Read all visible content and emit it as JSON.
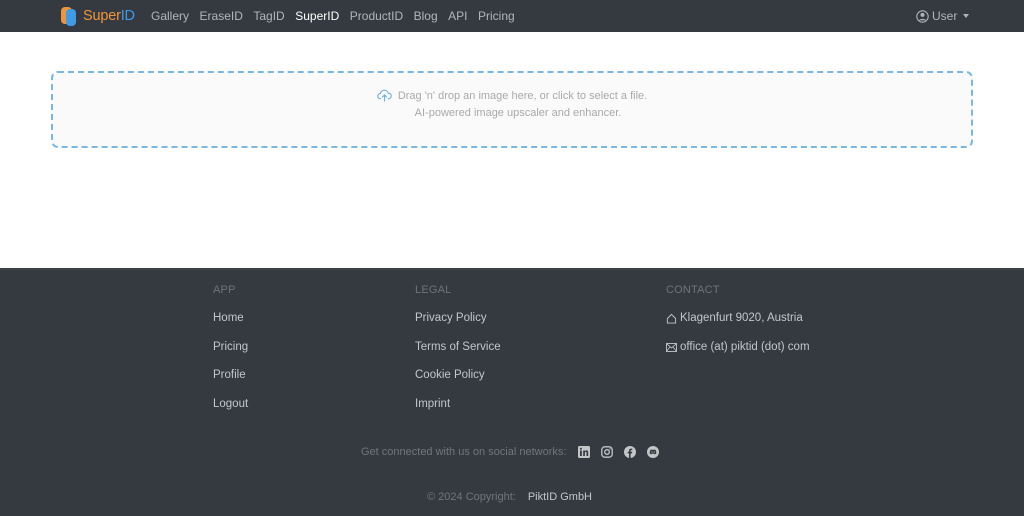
{
  "navbar": {
    "brand": {
      "part1": "Super",
      "part2": "ID"
    },
    "links": [
      {
        "label": "Gallery",
        "active": false
      },
      {
        "label": "EraseID",
        "active": false
      },
      {
        "label": "TagID",
        "active": false
      },
      {
        "label": "SuperID",
        "active": true
      },
      {
        "label": "ProductID",
        "active": false
      },
      {
        "label": "Blog",
        "active": false
      },
      {
        "label": "API",
        "active": false
      },
      {
        "label": "Pricing",
        "active": false
      }
    ],
    "user": {
      "icon": "user-circle-icon",
      "label": "User",
      "dropdown_icon": "caret-down-icon"
    }
  },
  "dropzone": {
    "icon": "cloud-upload-icon",
    "line1": "Drag 'n' drop an image here, or click to select a file.",
    "line2": "AI-powered image upscaler and enhancer.",
    "border_color": "#7ab7e3"
  },
  "footer": {
    "app": {
      "heading": "APP",
      "links": [
        "Home",
        "Pricing",
        "Profile",
        "Logout"
      ]
    },
    "legal": {
      "heading": "LEGAL",
      "links": [
        "Privacy Policy",
        "Terms of Service",
        "Cookie Policy",
        "Imprint"
      ]
    },
    "contact": {
      "heading": "CONTACT",
      "items": [
        {
          "icon": "house-icon",
          "text": "Klagenfurt 9020, Austria"
        },
        {
          "icon": "envelope-icon",
          "text": "office (at) piktid (dot) com"
        }
      ]
    },
    "social": {
      "text": "Get connected with us on social networks:",
      "icons": [
        "linkedin-icon",
        "instagram-icon",
        "facebook-icon",
        "discord-icon"
      ]
    },
    "copyright": {
      "text": "© 2024 Copyright:",
      "company": "PiktID GmbH"
    }
  },
  "colors": {
    "navbar_bg": "#343a40",
    "footer_bg": "#343a40",
    "brand_orange": "#f0953a",
    "brand_blue": "#3f9be8"
  }
}
